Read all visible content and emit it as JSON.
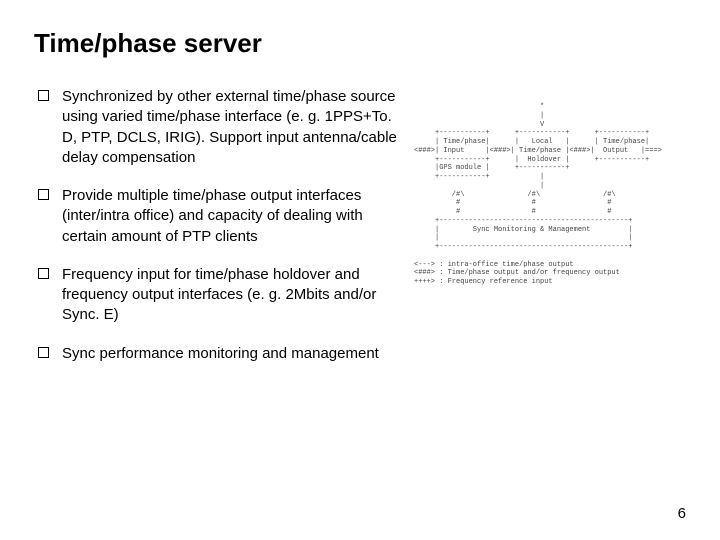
{
  "title": "Time/phase server",
  "bullets": [
    "Synchronized by other external time/phase source using varied time/phase interface (e. g. 1PPS+To. D, PTP, DCLS, IRIG). Support input antenna/cable delay compensation",
    "Provide multiple time/phase output interfaces (inter/intra office) and capacity of dealing with certain amount of PTP clients",
    "Frequency input for time/phase holdover and frequency output interfaces (e. g. 2Mbits and/or Sync. E)",
    "Sync performance monitoring and management"
  ],
  "diagram": "                              *\n                              |\n                              V\n     +-----------+      +-----------+      +-----------+\n     | Time/phase|      |   Local   |      | Time/phase|\n<###>| Input     |<###>| Time/phase |<###>|  Output   |===>\n     +-----------+      |  Holdover |      +-----------+\n     |GPS module |      +-----------+\n     +-----------+            |\n                              |\n         /#\\               /#\\               /#\\\n          #                 #                 #\n          #                 #                 #\n     +---------------------------------------------+\n     |        Sync Monitoring & Management         |\n     |                                             |\n     +---------------------------------------------+\n\n<---> : intra-office time/phase output\n<###> : Time/phase output and/or frequency output\n++++> : Frequency reference input",
  "page_number": "6"
}
